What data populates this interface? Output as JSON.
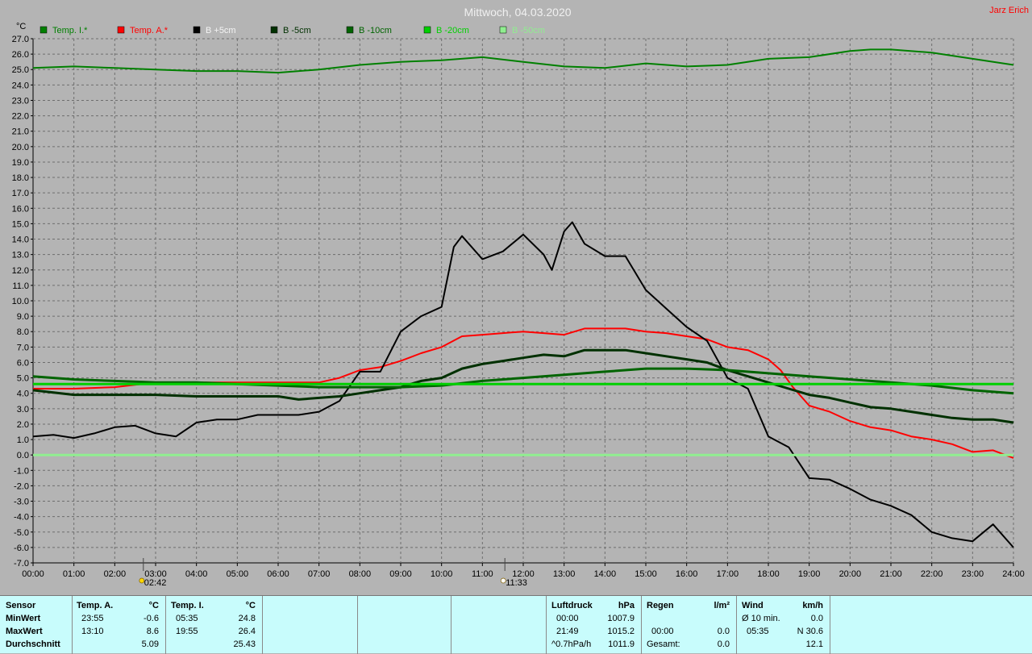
{
  "title": "Mittwoch, 04.03.2020",
  "author": "Jarz Erich",
  "chart_data": {
    "type": "line",
    "ylabel": "°C",
    "ylim": [
      -7,
      27
    ],
    "yticks": [
      "27.0",
      "26.0",
      "25.0",
      "24.0",
      "23.0",
      "22.0",
      "21.0",
      "20.0",
      "19.0",
      "18.0",
      "17.0",
      "16.0",
      "15.0",
      "14.0",
      "13.0",
      "12.0",
      "11.0",
      "10.0",
      "9.0",
      "8.0",
      "7.0",
      "6.0",
      "5.0",
      "4.0",
      "3.0",
      "2.0",
      "1.0",
      "0.0",
      "-1.0",
      "-2.0",
      "-3.0",
      "-4.0",
      "-5.0",
      "-6.0",
      "-7.0"
    ],
    "xlim": [
      0,
      24
    ],
    "xticks": [
      "00:00",
      "01:00",
      "02:00",
      "03:00",
      "04:00",
      "05:00",
      "06:00",
      "07:00",
      "08:00",
      "09:00",
      "10:00",
      "11:00",
      "12:00",
      "13:00",
      "14:00",
      "15:00",
      "16:00",
      "17:00",
      "18:00",
      "19:00",
      "20:00",
      "21:00",
      "22:00",
      "23:00",
      "24:00"
    ],
    "grid": true,
    "legend_position": "top-left",
    "markers": [
      {
        "label": "02:42",
        "x": 2.7,
        "icon": "sunrise-icon"
      },
      {
        "label": "11:33",
        "x": 11.55,
        "icon": "sunset-icon"
      }
    ],
    "series": [
      {
        "name": "Temp. I.*",
        "color": "#008000",
        "width": 2,
        "x": [
          0,
          1,
          2,
          3,
          4,
          5,
          6,
          7,
          8,
          9,
          10,
          11,
          12,
          13,
          14,
          15,
          16,
          17,
          18,
          19,
          20,
          20.5,
          21,
          22,
          23,
          24
        ],
        "y": [
          25.1,
          25.2,
          25.1,
          25.0,
          24.9,
          24.9,
          24.8,
          25.0,
          25.3,
          25.5,
          25.6,
          25.8,
          25.5,
          25.2,
          25.1,
          25.4,
          25.2,
          25.3,
          25.7,
          25.8,
          26.2,
          26.3,
          26.3,
          26.1,
          25.7,
          25.3
        ]
      },
      {
        "name": "Temp. A.*",
        "color": "#ff0000",
        "width": 2,
        "x": [
          0,
          1,
          2,
          3,
          4,
          5,
          6,
          7,
          7.5,
          8,
          8.5,
          9,
          9.5,
          10,
          10.5,
          11,
          11.5,
          12,
          12.5,
          13,
          13.5,
          14,
          14.5,
          15,
          15.5,
          16,
          16.5,
          17,
          17.5,
          18,
          18.3,
          18.6,
          19,
          19.5,
          20,
          20.5,
          21,
          21.5,
          22,
          22.5,
          23,
          23.5,
          24
        ],
        "y": [
          4.3,
          4.3,
          4.4,
          4.7,
          4.7,
          4.7,
          4.7,
          4.7,
          5.0,
          5.5,
          5.7,
          6.1,
          6.6,
          7.0,
          7.7,
          7.8,
          7.9,
          8.0,
          7.9,
          7.8,
          8.2,
          8.2,
          8.2,
          8.0,
          7.9,
          7.7,
          7.5,
          7.0,
          6.8,
          6.2,
          5.5,
          4.4,
          3.2,
          2.8,
          2.2,
          1.8,
          1.6,
          1.2,
          1.0,
          0.7,
          0.2,
          0.3,
          -0.2
        ]
      },
      {
        "name": "B +5cm",
        "color": "#000000",
        "width": 2,
        "x": [
          0,
          0.5,
          1,
          1.5,
          2,
          2.5,
          3,
          3.5,
          4,
          4.5,
          5,
          5.5,
          6,
          6.5,
          7,
          7.5,
          8,
          8.5,
          9,
          9.5,
          10,
          10.3,
          10.5,
          11,
          11.5,
          12,
          12.5,
          12.7,
          13,
          13.2,
          13.5,
          14,
          14.5,
          15,
          15.5,
          16,
          16.5,
          17,
          17.5,
          18,
          18.5,
          19,
          19.5,
          20,
          20.5,
          21,
          21.5,
          22,
          22.5,
          23,
          23.5,
          24
        ],
        "y": [
          1.2,
          1.3,
          1.1,
          1.4,
          1.8,
          1.9,
          1.4,
          1.2,
          2.1,
          2.3,
          2.3,
          2.6,
          2.6,
          2.6,
          2.8,
          3.5,
          5.4,
          5.4,
          8.0,
          9.0,
          9.6,
          13.5,
          14.2,
          12.7,
          13.2,
          14.3,
          13.0,
          12.0,
          14.5,
          15.1,
          13.7,
          12.9,
          12.9,
          10.7,
          9.5,
          8.3,
          7.4,
          5.0,
          4.3,
          1.2,
          0.5,
          -1.5,
          -1.6,
          -2.2,
          -2.9,
          -3.3,
          -3.9,
          -5.0,
          -5.4,
          -5.6,
          -4.5,
          -6.0
        ]
      },
      {
        "name": "B -5cm",
        "color": "#003000",
        "width": 3,
        "x": [
          0,
          1,
          2,
          3,
          4,
          5,
          6,
          6.5,
          7,
          7.5,
          8,
          8.5,
          9,
          9.5,
          10,
          10.5,
          11,
          11.5,
          12,
          12.5,
          13,
          13.5,
          14,
          14.5,
          15,
          15.5,
          16,
          16.5,
          17,
          17.5,
          18,
          18.5,
          19,
          19.5,
          20,
          20.5,
          21,
          21.5,
          22,
          22.5,
          23,
          23.5,
          24
        ],
        "y": [
          4.2,
          3.9,
          3.9,
          3.9,
          3.8,
          3.8,
          3.8,
          3.6,
          3.7,
          3.8,
          4.0,
          4.2,
          4.4,
          4.8,
          5.0,
          5.6,
          5.9,
          6.1,
          6.3,
          6.5,
          6.4,
          6.8,
          6.8,
          6.8,
          6.6,
          6.4,
          6.2,
          6.0,
          5.5,
          5.1,
          4.7,
          4.3,
          3.9,
          3.7,
          3.4,
          3.1,
          3.0,
          2.8,
          2.6,
          2.4,
          2.3,
          2.3,
          2.1
        ]
      },
      {
        "name": "B -10cm",
        "color": "#006400",
        "width": 3,
        "x": [
          0,
          1,
          2,
          3,
          4,
          5,
          6,
          7,
          8,
          9,
          10,
          11,
          12,
          13,
          14,
          15,
          16,
          17,
          18,
          19,
          20,
          21,
          22,
          23,
          24
        ],
        "y": [
          5.1,
          4.9,
          4.8,
          4.7,
          4.7,
          4.6,
          4.5,
          4.4,
          4.4,
          4.4,
          4.5,
          4.8,
          5.0,
          5.2,
          5.4,
          5.6,
          5.6,
          5.5,
          5.3,
          5.1,
          4.9,
          4.7,
          4.5,
          4.2,
          4.0
        ]
      },
      {
        "name": "B -20cm",
        "color": "#00d000",
        "width": 3,
        "x": [
          0,
          24
        ],
        "y": [
          4.6,
          4.6
        ]
      },
      {
        "name": "B -50cm",
        "color": "#90ee90",
        "width": 3,
        "x": [
          0,
          24
        ],
        "y": [
          0.0,
          0.0
        ]
      }
    ]
  },
  "footer": {
    "sensor": {
      "header": "Sensor",
      "min": "MinWert",
      "max": "MaxWert",
      "avg": "Durchschnitt"
    },
    "temp_a": {
      "header": "Temp. A.",
      "unit": "°C",
      "min_time": "23:55",
      "min": "-0.6",
      "max_time": "13:10",
      "max": "8.6",
      "avg": "5.09"
    },
    "temp_i": {
      "header": "Temp. I.",
      "unit": "°C",
      "min_time": "05:35",
      "min": "24.8",
      "max_time": "19:55",
      "max": "26.4",
      "avg": "25.43"
    },
    "pressure": {
      "header": "Luftdruck",
      "unit": "hPa",
      "min_time": "00:00",
      "min": "1007.9",
      "max_time": "21:49",
      "max": "1015.2",
      "trend": "^0.7hPa/h",
      "avg": "1011.9"
    },
    "rain": {
      "header": "Regen",
      "unit": "l/m²",
      "max_time": "00:00",
      "max": "0.0",
      "total_label": "Gesamt:",
      "total": "0.0"
    },
    "wind": {
      "header": "Wind",
      "unit": "km/h",
      "avg10_label": "Ø 10 min.",
      "avg10": "0.0",
      "max_time": "05:35",
      "max": "N 30.6",
      "avg": "12.1"
    }
  }
}
